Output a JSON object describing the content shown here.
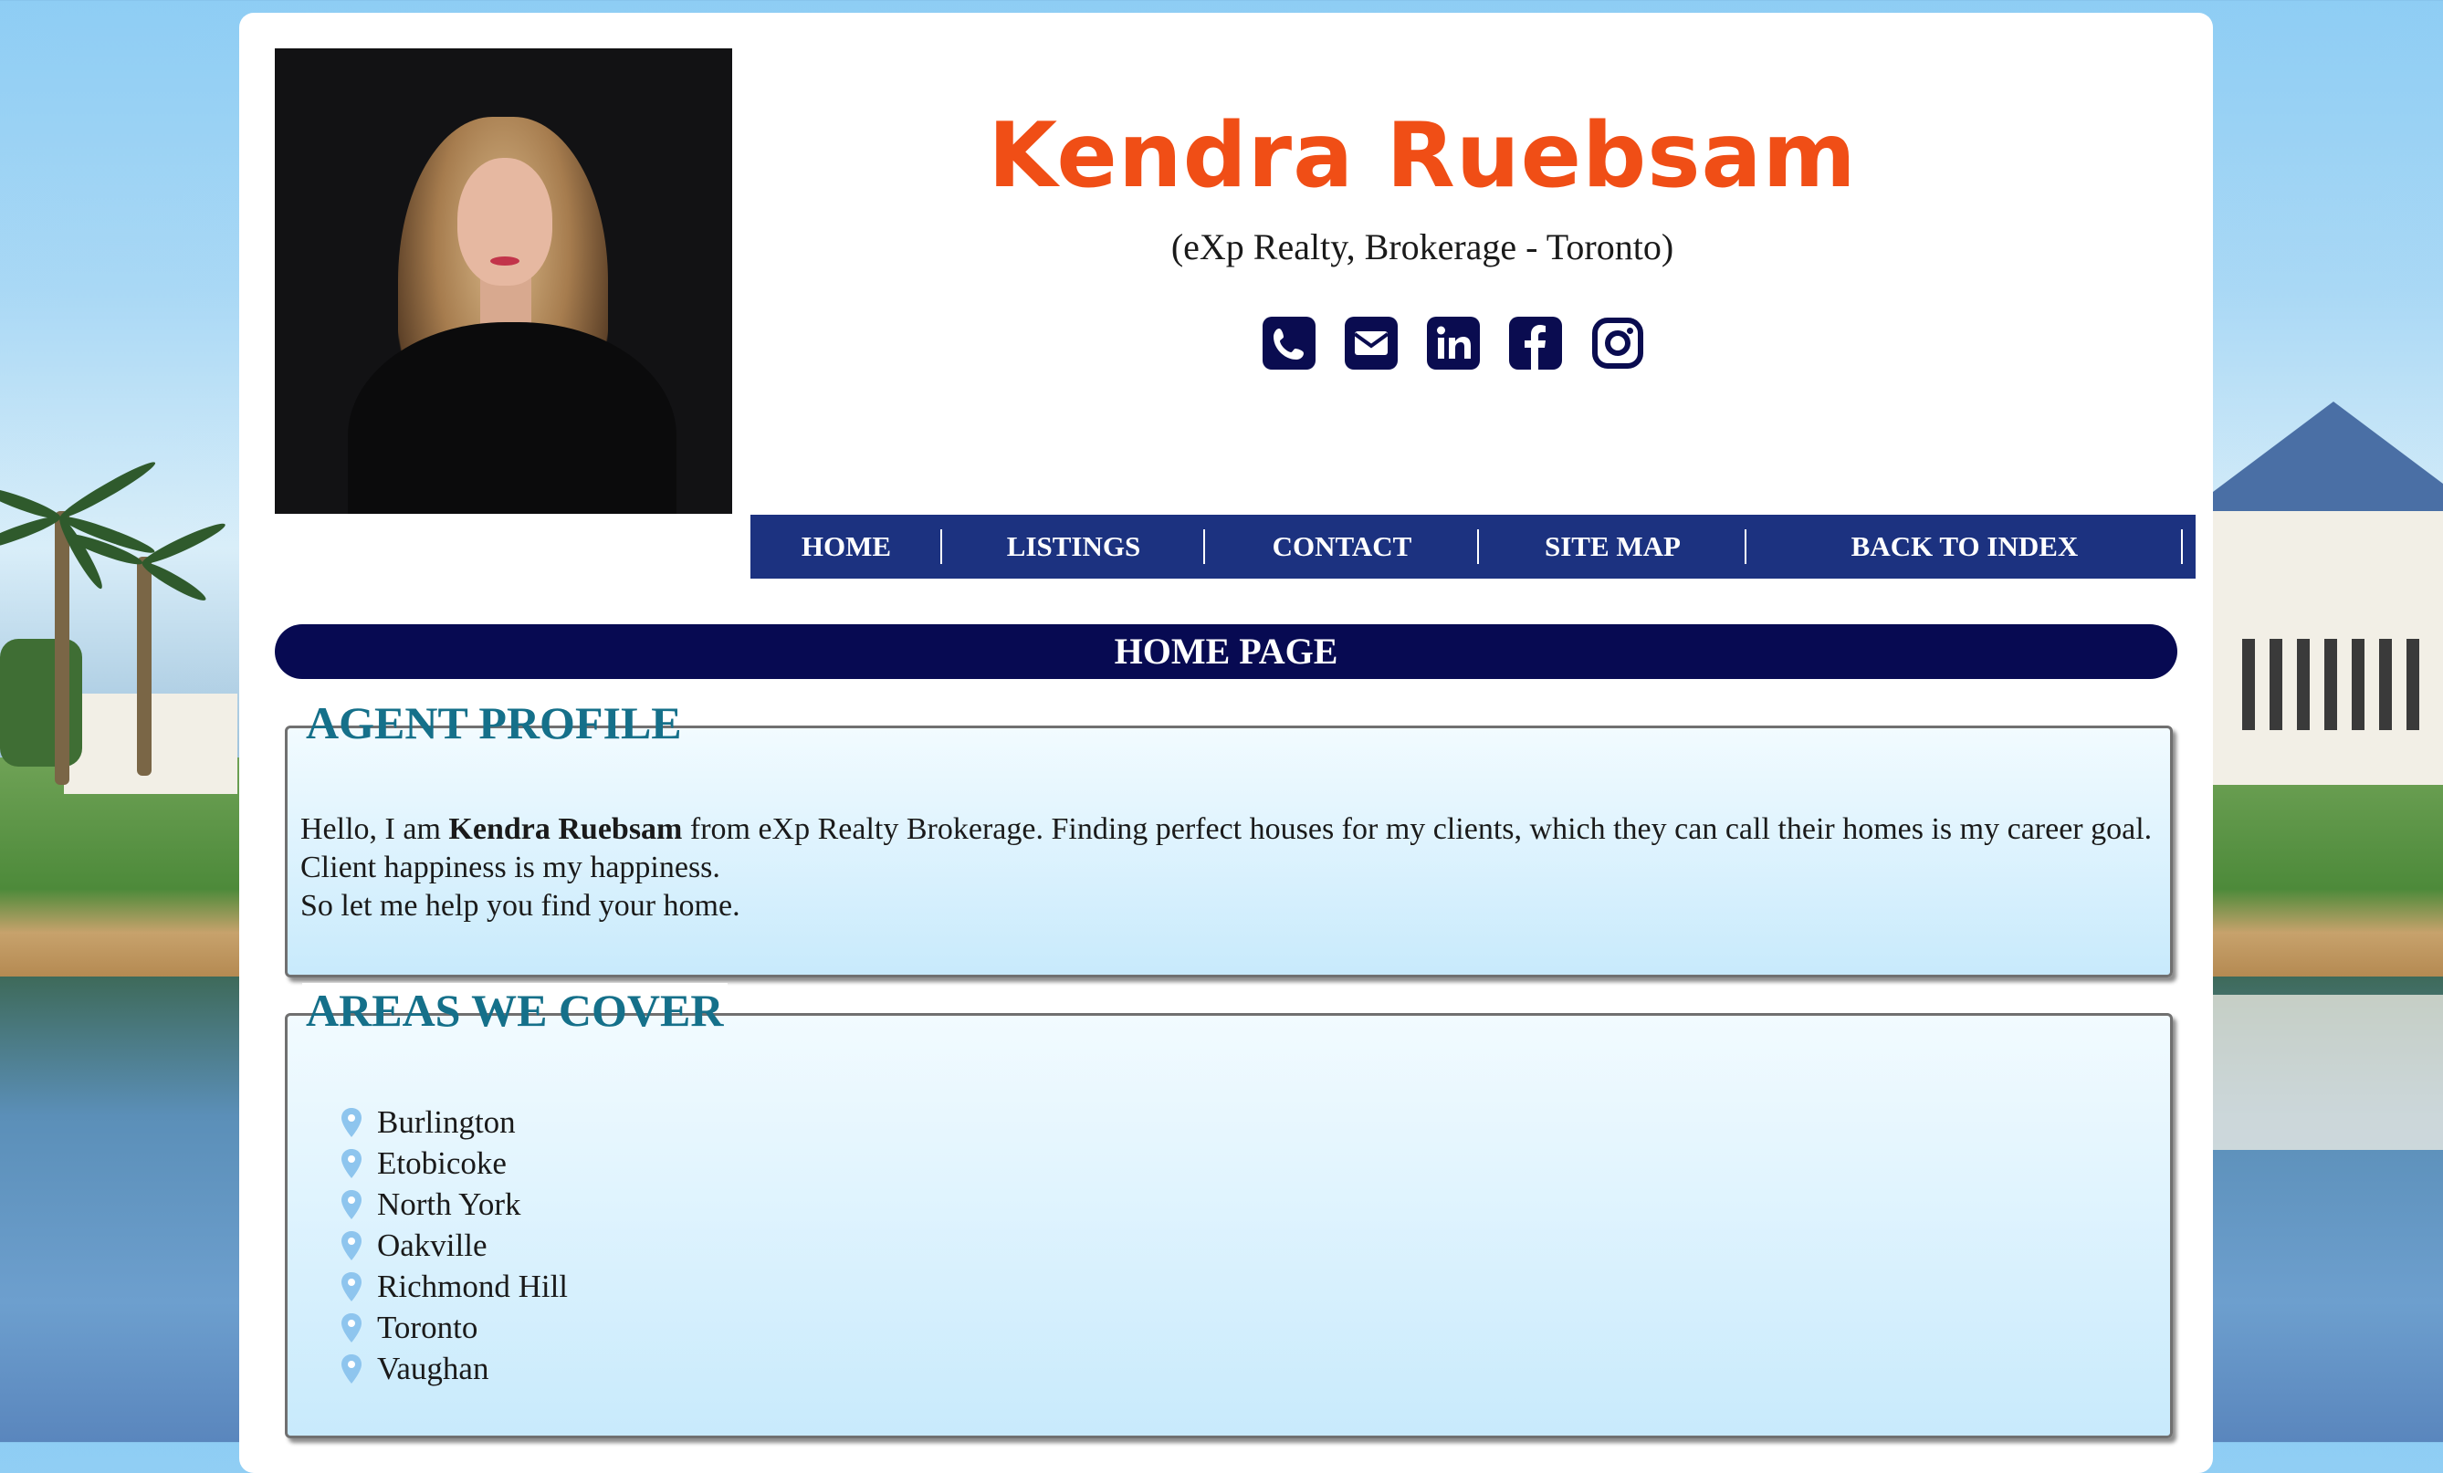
{
  "header": {
    "name": "Kendra Ruebsam",
    "subtitle": "(eXp Realty, Brokerage - Toronto)",
    "name_color": "#f04e16",
    "social_icons": [
      "phone-icon",
      "envelope-icon",
      "linkedin-icon",
      "facebook-icon",
      "instagram-icon"
    ],
    "icon_color": "#0a0c50"
  },
  "nav": {
    "items": [
      "HOME",
      "LISTINGS",
      "CONTACT",
      "SITE MAP",
      "BACK TO INDEX"
    ],
    "background": "#1c3280"
  },
  "home_bar": {
    "label": "HOME PAGE",
    "background": "#070a52"
  },
  "profile": {
    "title": "AGENT PROFILE",
    "text_before": "Hello, I am ",
    "text_bold": "Kendra Ruebsam",
    "text_after": " from eXp Realty Brokerage. Finding perfect houses for my clients, which they can call their homes is my career goal. Client happiness is my happiness.",
    "text_line2": "So let me help you find your home."
  },
  "areas": {
    "title": "AREAS WE COVER",
    "items": [
      "Burlington",
      "Etobicoke",
      "North York",
      "Oakville",
      "Richmond Hill",
      "Toronto",
      "Vaughan"
    ],
    "pin_color": "#8ec5ee"
  },
  "accent_title_color": "#15708a"
}
